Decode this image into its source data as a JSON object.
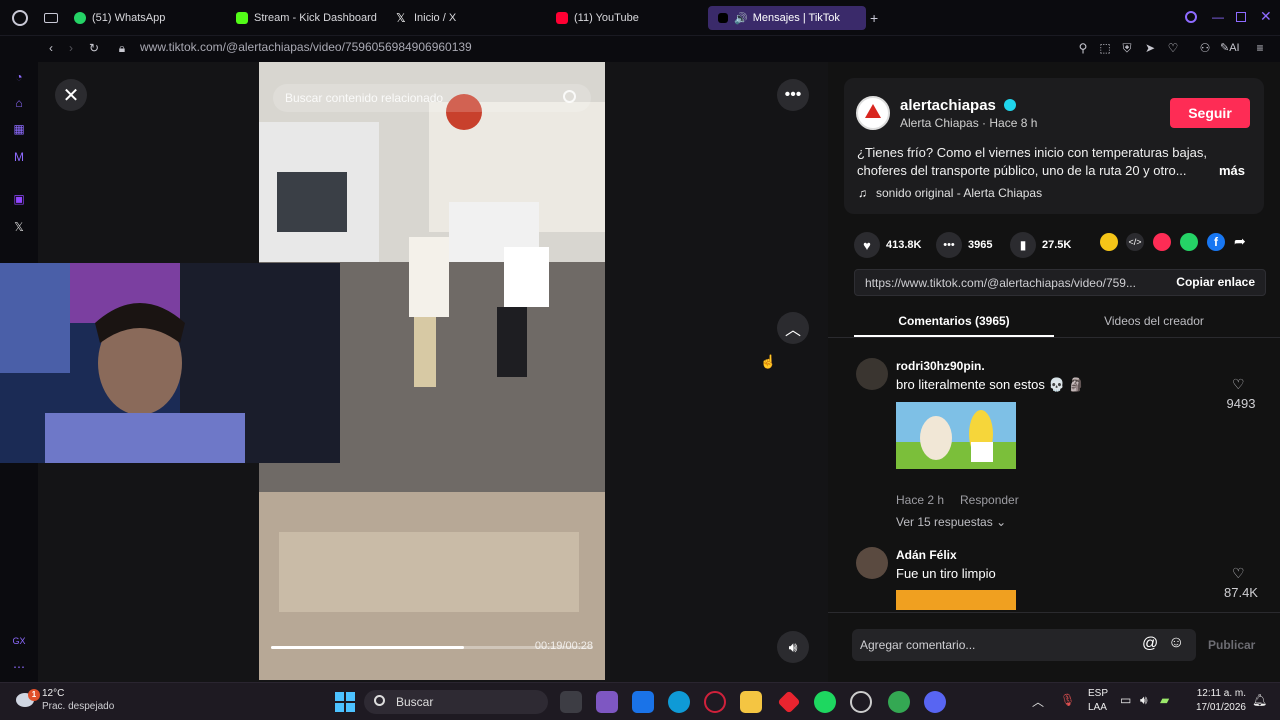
{
  "tabs": [
    {
      "label": "(51) WhatsApp",
      "color": "#25d366"
    },
    {
      "label": "Stream - Kick Dashboard",
      "color": "#53fc18"
    },
    {
      "label": "Inicio / X",
      "color": "#ffffff"
    },
    {
      "label": "(11) YouTube",
      "color": "#ff0033"
    },
    {
      "label": "Mensajes | TikTok",
      "color": "#ffffff"
    }
  ],
  "address": {
    "url": "www.tiktok.com/@alertachiapas/video/7596056984906960139"
  },
  "video": {
    "search_placeholder": "Buscar contenido relacionado",
    "time": "00:19/00:28",
    "progress": 0.6
  },
  "post": {
    "username": "alertachiapas",
    "display": "Alerta Chiapas · Hace 8 h",
    "follow_label": "Seguir",
    "caption_line1": "¿Tienes frío? Como el viernes inicio con temperaturas bajas,",
    "caption_line2": "choferes del transporte público, uno de la ruta 20 y otro...",
    "more_label": "más",
    "sound": "sonido original - Alerta Chiapas",
    "likes": "413.8K",
    "comments": "3965",
    "saves": "27.5K",
    "link": "https://www.tiktok.com/@alertachiapas/video/759...",
    "copy_label": "Copiar enlace"
  },
  "tabs_panel": {
    "comments": "Comentarios (3965)",
    "creator": "Videos del creador"
  },
  "comments": [
    {
      "user": "rodri30hz90pin.",
      "text": "bro literalmente son estos 💀 🗿",
      "likes": "9493",
      "time": "Hace 2 h",
      "reply": "Responder",
      "replies": "Ver 15 respuestas"
    },
    {
      "user": "Adán Félix",
      "text": "Fue un tiro limpio",
      "likes": "87.4K"
    }
  ],
  "composer": {
    "placeholder": "Agregar comentario...",
    "publish": "Publicar"
  },
  "taskbar": {
    "temp": "12°C",
    "weather": "Prac. despejado",
    "search": "Buscar",
    "lang1": "ESP",
    "lang2": "LAA",
    "time": "12:11 a. m.",
    "date": "17/01/2026",
    "badge": "1"
  }
}
